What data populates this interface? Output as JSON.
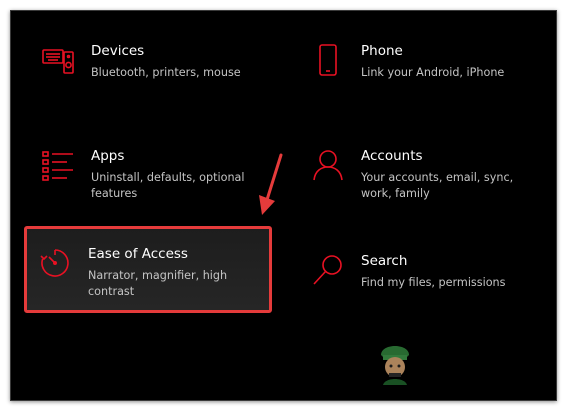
{
  "tiles": [
    {
      "id": "devices",
      "title": "Devices",
      "description": "Bluetooth, printers, mouse",
      "icon": "keyboard-speaker-icon"
    },
    {
      "id": "phone",
      "title": "Phone",
      "description": "Link your Android, iPhone",
      "icon": "phone-icon"
    },
    {
      "id": "apps",
      "title": "Apps",
      "description": "Uninstall, defaults, optional features",
      "icon": "apps-list-icon"
    },
    {
      "id": "accounts",
      "title": "Accounts",
      "description": "Your accounts, email, sync, work, family",
      "icon": "person-icon"
    },
    {
      "id": "ease",
      "title": "Ease of Access",
      "description": "Narrator, magnifier, high contrast",
      "icon": "timer-icon",
      "highlighted": true
    },
    {
      "id": "search",
      "title": "Search",
      "description": "Find my files, permissions",
      "icon": "magnifier-icon"
    }
  ],
  "colors": {
    "accent": "#e81123",
    "highlight_border": "#e53b3b",
    "background": "#000000"
  }
}
